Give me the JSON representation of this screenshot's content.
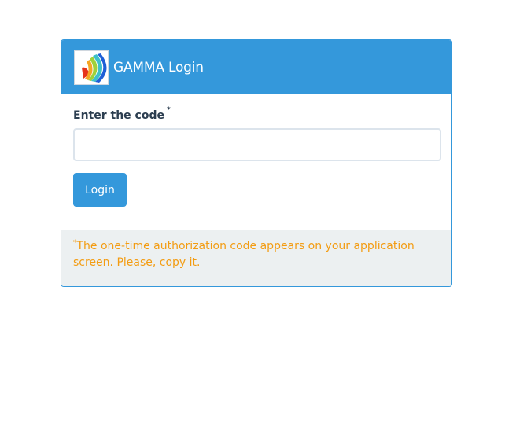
{
  "header": {
    "logo_icon": "gamma-logo-icon",
    "title": "GAMMA Login"
  },
  "form": {
    "label": "Enter the code",
    "required_mark": "*",
    "input_value": "",
    "input_placeholder": "",
    "login_label": "Login"
  },
  "footer": {
    "note_mark": "*",
    "note": "The one-time authorization code appears on your application screen. Please, copy it."
  },
  "colors": {
    "primary": "#3498db",
    "text": "#2c3e50",
    "warning": "#f39c12",
    "footer_bg": "#ecf0f1"
  }
}
